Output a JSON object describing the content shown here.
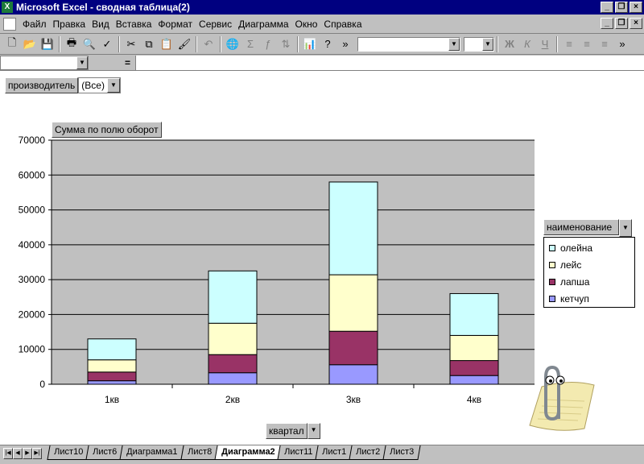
{
  "window": {
    "title": "Microsoft Excel - сводная таблица(2)",
    "app_icon": "excel-icon"
  },
  "menu": [
    "Файл",
    "Правка",
    "Вид",
    "Вставка",
    "Формат",
    "Сервис",
    "Диаграмма",
    "Окно",
    "Справка"
  ],
  "formula_bar": {
    "name_box": "",
    "equals": "="
  },
  "pivot": {
    "page_field": {
      "label": "производитель",
      "value": "(Все)"
    },
    "data_field": "Сумма по полю оборот",
    "series_field": "наименование",
    "category_field": "квартал"
  },
  "chart_data": {
    "type": "bar",
    "stacked": true,
    "categories": [
      "1кв",
      "2кв",
      "3кв",
      "4кв"
    ],
    "series": [
      {
        "name": "кетчуп",
        "color": "#9999ff",
        "values": [
          1000,
          3300,
          5600,
          2500
        ]
      },
      {
        "name": "лапша",
        "color": "#993366",
        "values": [
          2500,
          5200,
          9600,
          4300
        ]
      },
      {
        "name": "лейс",
        "color": "#ffffcc",
        "values": [
          3500,
          9000,
          16200,
          7200
        ]
      },
      {
        "name": "олейна",
        "color": "#ccffff",
        "values": [
          6000,
          15000,
          26600,
          12000
        ]
      }
    ],
    "ylim": [
      0,
      70000
    ],
    "yticks": [
      "0",
      "10000",
      "20000",
      "30000",
      "40000",
      "50000",
      "60000",
      "70000"
    ],
    "plot_background": "#c0c0c0",
    "grid": true,
    "legend": "right"
  },
  "sheet_tabs": [
    "Лист10",
    "Лист6",
    "Диаграмма1",
    "Лист8",
    "Диаграмма2",
    "Лист11",
    "Лист1",
    "Лист2",
    "Лист3"
  ],
  "active_tab": "Диаграмма2"
}
